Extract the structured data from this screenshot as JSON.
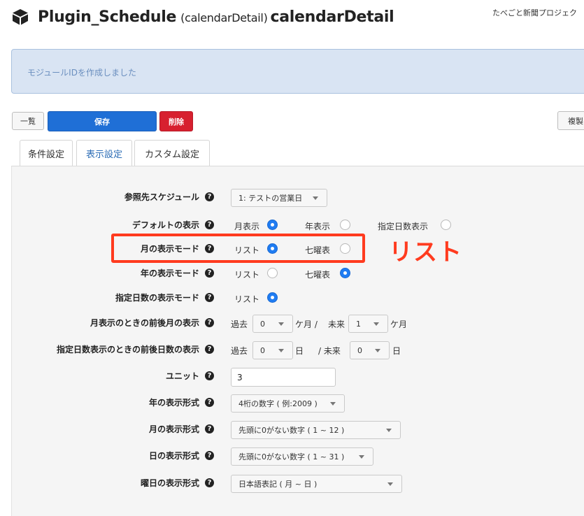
{
  "header": {
    "title_main": "Plugin_Schedule",
    "title_sub": "(calendarDetail)",
    "title_tail": "calendarDetail",
    "site_name": "たべごと新聞プロジェク"
  },
  "alert": {
    "message": "モジュールIDを作成しました"
  },
  "toolbar": {
    "list_label": "一覧",
    "save_label": "保存",
    "delete_label": "削除",
    "copy_label": "複製"
  },
  "tabs": [
    {
      "label": "条件設定"
    },
    {
      "label": "表示設定"
    },
    {
      "label": "カスタム設定"
    }
  ],
  "help_glyph": "?",
  "form": {
    "schedule": {
      "label": "参照先スケジュール",
      "value": "1: テストの営業日"
    },
    "default_view": {
      "label": "デフォルトの表示",
      "options": [
        {
          "label": "月表示",
          "checked": true
        },
        {
          "label": "年表示",
          "checked": false
        },
        {
          "label": "指定日数表示",
          "checked": false
        }
      ]
    },
    "month_mode": {
      "label": "月の表示モード",
      "options": [
        {
          "label": "リスト",
          "checked": true
        },
        {
          "label": "七曜表",
          "checked": false
        }
      ]
    },
    "year_mode": {
      "label": "年の表示モード",
      "options": [
        {
          "label": "リスト",
          "checked": false
        },
        {
          "label": "七曜表",
          "checked": true
        }
      ]
    },
    "days_mode": {
      "label": "指定日数の表示モード",
      "options": [
        {
          "label": "リスト",
          "checked": true
        }
      ]
    },
    "month_range": {
      "label": "月表示のときの前後月の表示",
      "past_label": "過去",
      "past_value": "0",
      "past_unit": "ケ月 /",
      "future_label": "未来",
      "future_value": "1",
      "future_unit": "ケ月"
    },
    "days_range": {
      "label": "指定日数表示のときの前後日数の表示",
      "past_label": "過去",
      "past_value": "0",
      "past_unit": "日",
      "future_label": "/ 未来",
      "future_value": "0",
      "future_unit": "日"
    },
    "unit": {
      "label": "ユニット",
      "value": "3"
    },
    "year_format": {
      "label": "年の表示形式",
      "value": "4桁の数字 ( 例:2009 )"
    },
    "month_format": {
      "label": "月の表示形式",
      "value": "先頭に0がない数字 ( 1 ~ 12 )"
    },
    "day_format": {
      "label": "日の表示形式",
      "value": "先頭に0がない数字 ( 1 ~ 31 )"
    },
    "weekday_format": {
      "label": "曜日の表示形式",
      "value": "日本語表記 ( 月 ~ 日 )"
    }
  },
  "annotation": {
    "text": "リスト",
    "color": "#ff3b1f"
  },
  "colors": {
    "primary": "#1f6fd6",
    "danger": "#d7202f",
    "radio_on": "#1f7cf2"
  }
}
